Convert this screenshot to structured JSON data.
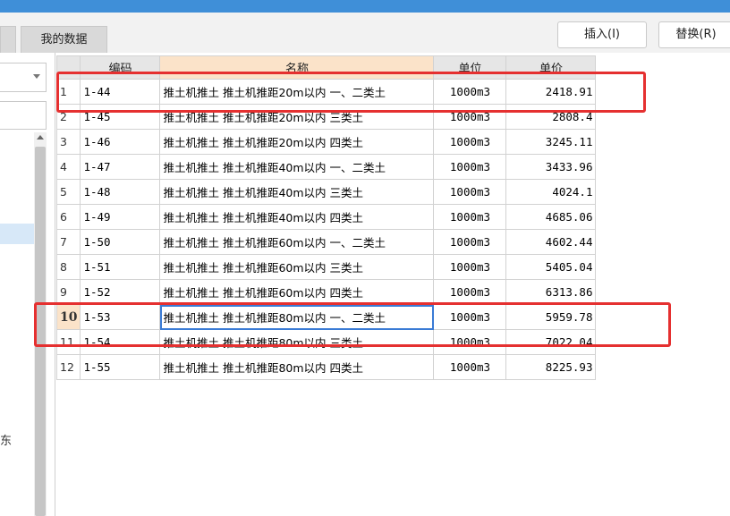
{
  "tabs": [
    {
      "label": "我的数据"
    }
  ],
  "buttons": {
    "insert": "插入(I)",
    "replace": "替换(R)"
  },
  "left_panel": {
    "partial_text": "东"
  },
  "table": {
    "columns": [
      "编码",
      "名称",
      "单位",
      "单价"
    ],
    "active_row": 10,
    "rows": [
      {
        "no": "1",
        "code": "1-44",
        "name": "推土机推土 推土机推距20m以内 一、二类土",
        "unit": "1000m3",
        "price": "2418.91"
      },
      {
        "no": "2",
        "code": "1-45",
        "name": "推土机推土 推土机推距20m以内 三类土",
        "unit": "1000m3",
        "price": "2808.4"
      },
      {
        "no": "3",
        "code": "1-46",
        "name": "推土机推土 推土机推距20m以内 四类土",
        "unit": "1000m3",
        "price": "3245.11"
      },
      {
        "no": "4",
        "code": "1-47",
        "name": "推土机推土 推土机推距40m以内 一、二类土",
        "unit": "1000m3",
        "price": "3433.96"
      },
      {
        "no": "5",
        "code": "1-48",
        "name": "推土机推土 推土机推距40m以内 三类土",
        "unit": "1000m3",
        "price": "4024.1"
      },
      {
        "no": "6",
        "code": "1-49",
        "name": "推土机推土 推土机推距40m以内 四类土",
        "unit": "1000m3",
        "price": "4685.06"
      },
      {
        "no": "7",
        "code": "1-50",
        "name": "推土机推土 推土机推距60m以内 一、二类土",
        "unit": "1000m3",
        "price": "4602.44"
      },
      {
        "no": "8",
        "code": "1-51",
        "name": "推土机推土 推土机推距60m以内 三类土",
        "unit": "1000m3",
        "price": "5405.04"
      },
      {
        "no": "9",
        "code": "1-52",
        "name": "推土机推土 推土机推距60m以内 四类土",
        "unit": "1000m3",
        "price": "6313.86"
      },
      {
        "no": "10",
        "code": "1-53",
        "name": "推土机推土 推土机推距80m以内 一、二类土",
        "unit": "1000m3",
        "price": "5959.78"
      },
      {
        "no": "11",
        "code": "1-54",
        "name": "推土机推土 推土机推距80m以内 三类土",
        "unit": "1000m3",
        "price": "7022.04"
      },
      {
        "no": "12",
        "code": "1-55",
        "name": "推土机推土 推土机推距80m以内 四类土",
        "unit": "1000m3",
        "price": "8225.93"
      }
    ]
  },
  "colors": {
    "annotation": "#e53030",
    "selection": "#3a7bd5",
    "header_highlight": "#fbe3c9",
    "titlebar": "#3f8fd8"
  }
}
